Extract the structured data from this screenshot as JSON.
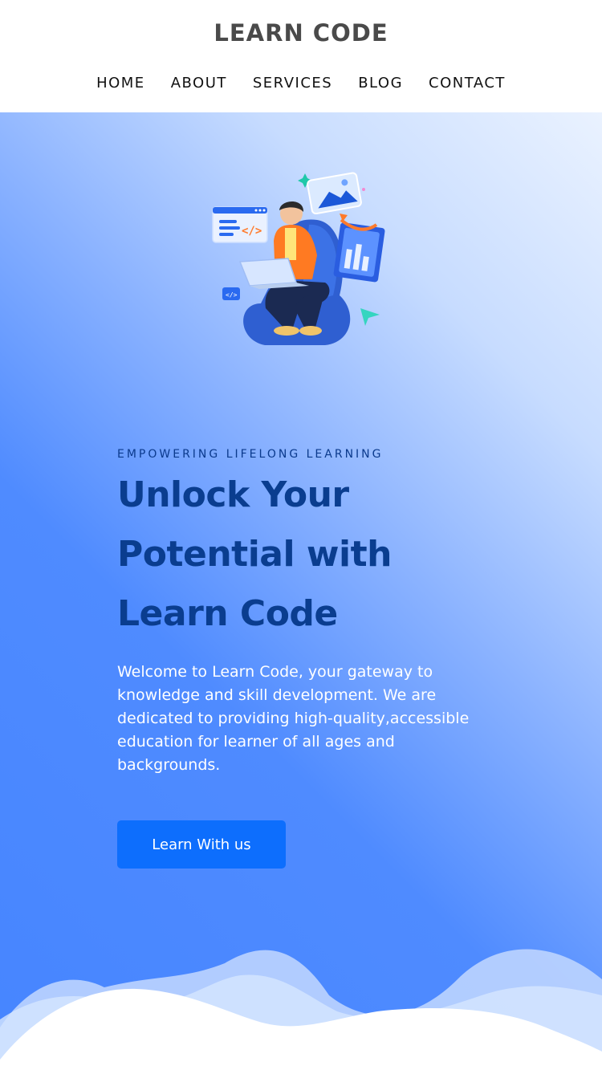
{
  "brand": {
    "name": "LEARN CODE"
  },
  "nav": {
    "items": [
      {
        "label": "HOME"
      },
      {
        "label": "ABOUT"
      },
      {
        "label": "SERVICES"
      },
      {
        "label": "BLOG"
      },
      {
        "label": "CONTACT"
      }
    ]
  },
  "hero": {
    "eyebrow": "EMPOWERING LIFELONG LEARNING",
    "headline": "Unlock Your Potential with Learn Code",
    "intro": "Welcome to Learn Code, your gateway to knowledge and skill development. We are dedicated to providing high-quality,accessible education for learner of all ages and backgrounds.",
    "cta_label": "Learn With us",
    "illustration_icon": "student-laptop-illustration"
  },
  "colors": {
    "accent": "#0d6efd",
    "headline": "#0a3d8f",
    "hero_gradient_start": "#4685ff",
    "hero_gradient_end": "#eaf2ff"
  }
}
